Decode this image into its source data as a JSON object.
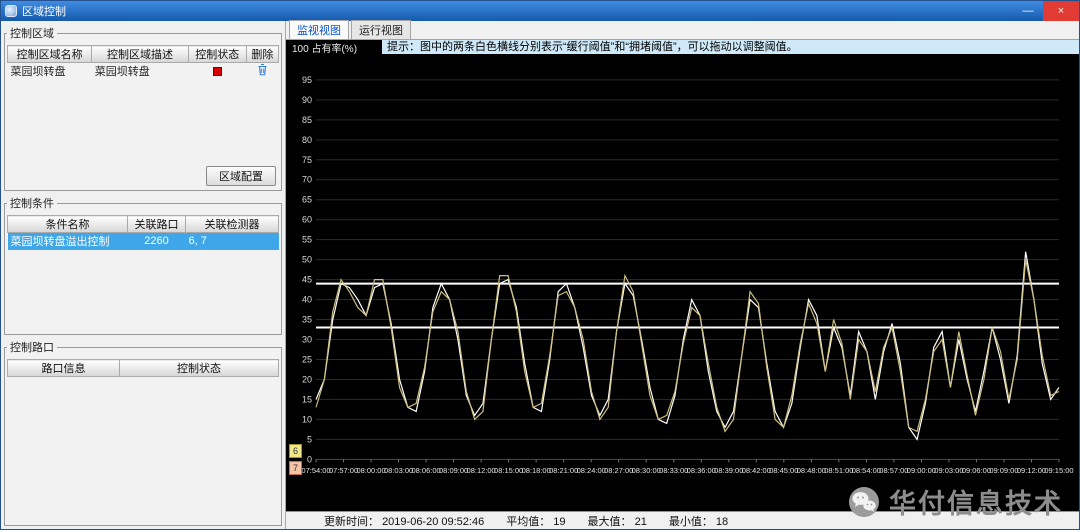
{
  "window": {
    "title": "区域控制",
    "minimize": "—",
    "close": "×"
  },
  "left": {
    "region_group": {
      "legend": "控制区域",
      "columns": [
        "控制区域名称",
        "控制区域描述",
        "控制状态",
        "删除"
      ],
      "rows": [
        {
          "name": "菜园坝转盘",
          "desc": "菜园坝转盘"
        }
      ],
      "config_button": "区域配置"
    },
    "condition_group": {
      "legend": "控制条件",
      "columns": [
        "条件名称",
        "关联路口",
        "关联检测器"
      ],
      "rows": [
        {
          "name": "菜园坝转盘溢出控制",
          "junction": "2260",
          "detectors": "6, 7"
        }
      ]
    },
    "junction_group": {
      "legend": "控制路口",
      "columns": [
        "路口信息",
        "控制状态"
      ]
    }
  },
  "tabs": [
    {
      "label": "监视视图",
      "active": true
    },
    {
      "label": "运行视图",
      "active": false
    }
  ],
  "hint": "提示：图中的两条白色横线分别表示“缓行阈值”和“拥堵阈值”，可以拖动以调整阈值。",
  "chart_data": {
    "type": "line",
    "title": "占有率(%)",
    "ylabel": "占有率(%)",
    "top_tick": "100",
    "ylim": [
      0,
      100
    ],
    "ytick_step": 5,
    "grid": true,
    "background": "#000000",
    "x_labels": [
      "07:54:00",
      "07:57:00",
      "08:00:00",
      "08:03:00",
      "08:06:00",
      "08:09:00",
      "08:12:00",
      "08:15:00",
      "08:18:00",
      "08:21:00",
      "08:24:00",
      "08:27:00",
      "08:30:00",
      "08:33:00",
      "08:36:00",
      "08:39:00",
      "08:42:00",
      "08:45:00",
      "08:48:00",
      "08:51:00",
      "08:54:00",
      "08:57:00",
      "09:00:00",
      "09:03:00",
      "09:06:00",
      "09:09:00",
      "09:12:00",
      "09:15:00"
    ],
    "thresholds": [
      {
        "name": "缓行阈值",
        "value": 44
      },
      {
        "name": "拥堵阈值",
        "value": 33
      }
    ],
    "series": [
      {
        "name": "检测器6",
        "color": "#ffffff",
        "values": [
          15,
          20,
          35,
          44,
          43,
          40,
          36,
          43,
          44,
          34,
          20,
          13,
          12,
          22,
          38,
          44,
          40,
          30,
          16,
          11,
          14,
          30,
          44,
          45,
          38,
          24,
          13,
          12,
          25,
          42,
          44,
          38,
          28,
          16,
          11,
          15,
          32,
          44,
          41,
          30,
          18,
          10,
          9,
          16,
          30,
          40,
          36,
          22,
          12,
          8,
          12,
          26,
          40,
          38,
          24,
          12,
          8,
          14,
          28,
          40,
          36,
          22,
          33,
          28,
          16,
          32,
          27,
          15,
          27,
          34,
          24,
          8,
          5,
          14,
          28,
          32,
          18,
          30,
          20,
          12,
          22,
          33,
          25,
          14,
          26,
          52,
          40,
          24,
          15,
          18
        ]
      },
      {
        "name": "检测器7",
        "color": "#cdbd7f",
        "values": [
          13,
          20,
          37,
          45,
          42,
          38,
          36,
          45,
          45,
          33,
          18,
          13,
          14,
          23,
          37,
          42,
          40,
          32,
          17,
          10,
          12,
          30,
          46,
          46,
          37,
          22,
          13,
          14,
          26,
          41,
          42,
          38,
          30,
          17,
          10,
          13,
          32,
          46,
          42,
          29,
          16,
          10,
          11,
          17,
          29,
          38,
          36,
          24,
          13,
          7,
          10,
          26,
          42,
          39,
          23,
          10,
          8,
          16,
          29,
          39,
          34,
          22,
          35,
          29,
          15,
          30,
          27,
          17,
          28,
          33,
          22,
          8,
          7,
          15,
          27,
          30,
          18,
          32,
          21,
          11,
          20,
          33,
          27,
          15,
          25,
          50,
          40,
          26,
          16,
          17
        ]
      }
    ]
  },
  "legend_badges": [
    {
      "label": "6",
      "color": "#efe98b"
    },
    {
      "label": "7",
      "color": "#f6c3a9"
    }
  ],
  "status": {
    "update_label": "更新时间： ",
    "update_value": "2019-06-20 09:52:46",
    "avg_label": "平均值： ",
    "avg_value": "19",
    "max_label": "最大值： ",
    "max_value": "21",
    "min_label": "最小值： ",
    "min_value": "18"
  },
  "watermark": {
    "text": "华付信息技术"
  }
}
